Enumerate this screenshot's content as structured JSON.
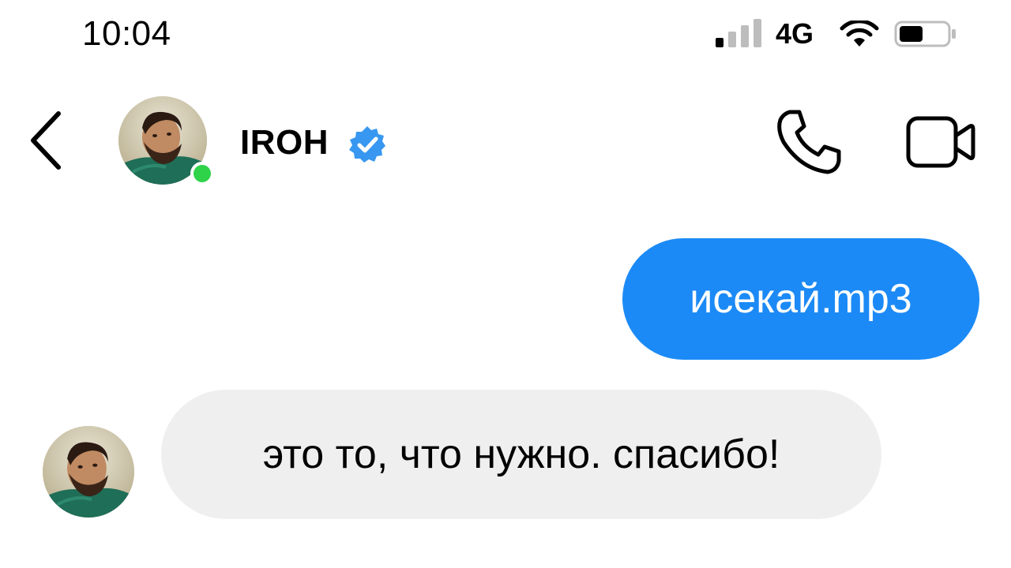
{
  "status_bar": {
    "time": "10:04",
    "network": "4G",
    "icons": [
      "signal-icon",
      "wifi-icon",
      "battery-icon"
    ],
    "signal_bars_active": 1,
    "signal_bars_total": 4,
    "battery_level": 0.5
  },
  "header": {
    "contact_name": "IROH",
    "verified": true,
    "online": true,
    "icons": [
      "back-chevron-icon",
      "verified-badge-icon",
      "phone-icon",
      "video-camera-icon"
    ]
  },
  "messages": [
    {
      "direction": "outgoing",
      "text": "исекай.mp3"
    },
    {
      "direction": "incoming",
      "text": "это то, что нужно. спасибо!"
    }
  ],
  "colors": {
    "outgoing_bubble": "#1c8af6",
    "incoming_bubble": "#efefef",
    "verified_badge": "#3897f0",
    "online_indicator": "#2fd34a",
    "text_primary": "#000000",
    "text_on_accent": "#ffffff"
  }
}
